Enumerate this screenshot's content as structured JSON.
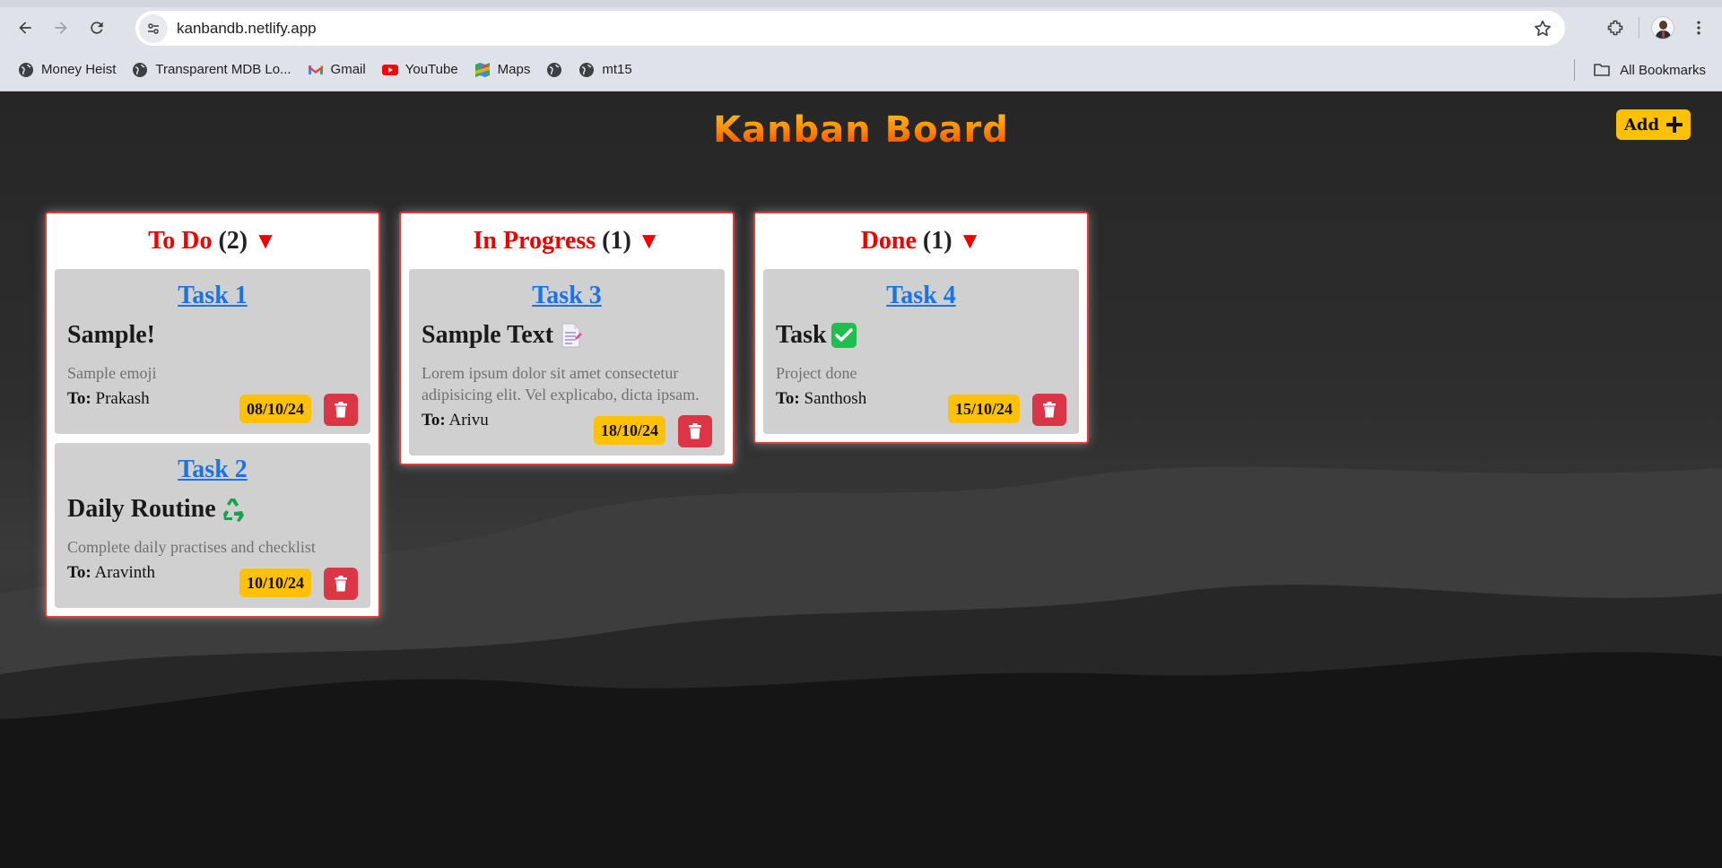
{
  "browser": {
    "url": "kanbandb.netlify.app",
    "bookmarks": [
      {
        "label": "Money Heist",
        "icon": "globe-icon"
      },
      {
        "label": "Transparent MDB Lo...",
        "icon": "globe-icon"
      },
      {
        "label": "Gmail",
        "icon": "gmail-icon"
      },
      {
        "label": "YouTube",
        "icon": "youtube-icon"
      },
      {
        "label": "Maps",
        "icon": "maps-icon"
      },
      {
        "label": "",
        "icon": "globe-icon"
      },
      {
        "label": "mt15",
        "icon": "globe-icon"
      }
    ],
    "all_bookmarks": "All Bookmarks"
  },
  "board": {
    "title": "Kanban Board",
    "add_label": "Add",
    "columns": [
      {
        "name": "To Do",
        "count": "(2)",
        "arrow": "▼",
        "cards": [
          {
            "link": "Task 1",
            "title": "Sample!",
            "emoji": "",
            "desc": "Sample emoji",
            "to_label": "To:",
            "assignee": "Prakash",
            "date": "08/10/24"
          },
          {
            "link": "Task 2",
            "title": "Daily Routine",
            "emoji": "recycle-icon",
            "desc": "Complete daily practises and checklist",
            "to_label": "To:",
            "assignee": "Aravinth",
            "date": "10/10/24"
          }
        ]
      },
      {
        "name": "In Progress",
        "count": "(1)",
        "arrow": "▼",
        "cards": [
          {
            "link": "Task 3",
            "title": "Sample Text",
            "emoji": "memo-icon",
            "desc": "Lorem ipsum dolor sit amet consectetur adipisicing elit. Vel explicabo, dicta ipsam.",
            "to_label": "To:",
            "assignee": "Arivu",
            "date": "18/10/24"
          }
        ]
      },
      {
        "name": "Done",
        "count": "(1)",
        "arrow": "▼",
        "cards": [
          {
            "link": "Task 4",
            "title": "Task",
            "emoji": "check-mark-icon",
            "desc": "Project done",
            "to_label": "To:",
            "assignee": "Santhosh",
            "date": "15/10/24"
          }
        ]
      }
    ]
  },
  "colors": {
    "column_name": "#f00000",
    "link": "#1a73e8",
    "date_badge": "#ffc107",
    "delete_button": "#dc3545",
    "card_bg": "#d0d0d0"
  }
}
